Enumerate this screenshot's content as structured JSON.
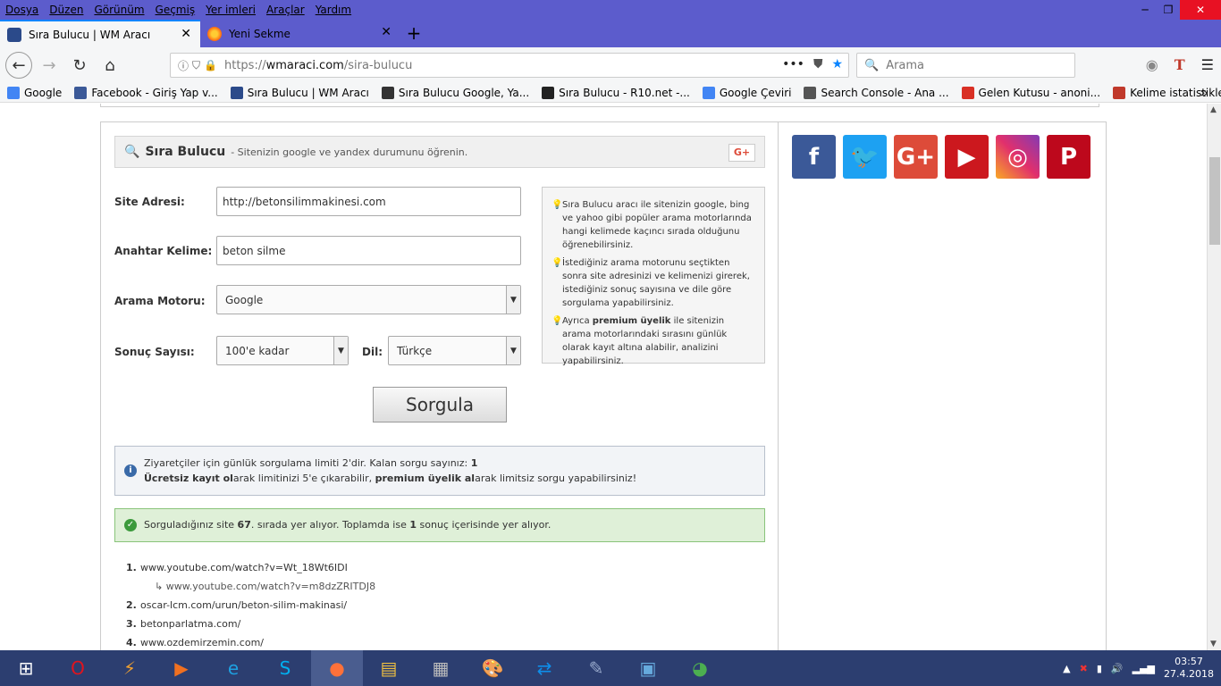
{
  "menu": {
    "items": [
      "Dosya",
      "Düzen",
      "Görünüm",
      "Geçmiş",
      "Yer imleri",
      "Araçlar",
      "Yardım"
    ]
  },
  "window_controls": {
    "minimize": "─",
    "restore": "❐",
    "close": "✕"
  },
  "tabs": [
    {
      "title": "Sıra Bulucu | WM Aracı",
      "active": true,
      "icon": "wm-icon"
    },
    {
      "title": "Yeni Sekme",
      "active": false,
      "icon": "firefox-icon"
    }
  ],
  "navbar": {
    "url_prefix": "https://",
    "url_host": "wmaraci.com",
    "url_path": "/sira-bulucu",
    "search_placeholder": "Arama"
  },
  "bookmarks": [
    {
      "label": "Google",
      "color": "#4285f4"
    },
    {
      "label": "Facebook - Giriş Yap v...",
      "color": "#3b5998"
    },
    {
      "label": "Sıra Bulucu | WM Aracı",
      "color": "#2b4a8a"
    },
    {
      "label": "Sıra Bulucu Google, Ya...",
      "color": "#333333"
    },
    {
      "label": "Sıra Bulucu - R10.net -...",
      "color": "#222222"
    },
    {
      "label": "Google Çeviri",
      "color": "#4285f4"
    },
    {
      "label": "Search Console - Ana ...",
      "color": "#555555"
    },
    {
      "label": "Gelen Kutusu - anoni...",
      "color": "#d93025"
    },
    {
      "label": "Kelime istatistikleri",
      "color": "#c0392b"
    }
  ],
  "panel": {
    "title": "Sıra Bulucu",
    "subtitle": "- Sitenizin google ve yandex durumunu öğrenin.",
    "gplus": "G+"
  },
  "form": {
    "site_label": "Site Adresi:",
    "site_value": "http://betonsilimmakinesi.com",
    "keyword_label": "Anahtar Kelime:",
    "keyword_value": "beton silme",
    "engine_label": "Arama Motoru:",
    "engine_value": "Google",
    "count_label": "Sonuç Sayısı:",
    "count_value": "100'e kadar",
    "lang_label": "Dil:",
    "lang_value": "Türkçe",
    "submit": "Sorgula"
  },
  "info": {
    "p1": "Sıra Bulucu aracı ile sitenizin google, bing ve yahoo gibi popüler arama motorlarında hangi kelimede kaçıncı sırada olduğunu öğrenebilirsiniz.",
    "p2": "İstediğiniz arama motorunu seçtikten sonra site adresinizi ve kelimenizi girerek, istediğiniz sonuç sayısına ve dile göre sorgulama yapabilirsiniz.",
    "p3a": "Ayrıca ",
    "p3b": "premium üyelik",
    "p3c": " ile sitenizin arama motorlarındaki sırasını günlük olarak kayıt altına alabilir, analizini yapabilirsiniz."
  },
  "notice": {
    "line1a": "Ziyaretçiler için günlük sorgulama limiti 2'dir. Kalan sorgu sayınız: ",
    "line1b": "1",
    "line2a": "Ücretsiz kayıt ol",
    "line2b": "arak limitinizi 5'e çıkarabilir, ",
    "line2c": "premium üyelik al",
    "line2d": "arak limitsiz sorgu yapabilirsiniz!"
  },
  "success": {
    "a": "Sorguladığınız site ",
    "rank": "67",
    "b": ". sırada yer alıyor. Toplamda ise ",
    "count": "1",
    "c": " sonuç içerisinde yer alıyor."
  },
  "results": [
    {
      "n": "1.",
      "url": "www.youtube.com/watch?v=Wt_18Wt6IDI"
    },
    {
      "n": "",
      "url": "↳ www.youtube.com/watch?v=m8dzZRITDJ8",
      "sub": true
    },
    {
      "n": "2.",
      "url": "oscar-lcm.com/urun/beton-silim-makinasi/"
    },
    {
      "n": "3.",
      "url": "betonparlatma.com/"
    },
    {
      "n": "4.",
      "url": "www.ozdemirzemin.com/"
    }
  ],
  "social": [
    {
      "name": "facebook",
      "glyph": "f",
      "color": "#3b5998"
    },
    {
      "name": "twitter",
      "glyph": "🐦",
      "color": "#1da1f2"
    },
    {
      "name": "google-plus",
      "glyph": "G+",
      "color": "#dd4b39"
    },
    {
      "name": "youtube",
      "glyph": "▶",
      "color": "#cc181e"
    },
    {
      "name": "instagram",
      "glyph": "◎",
      "color": "#c13584"
    },
    {
      "name": "pinterest",
      "glyph": "P",
      "color": "#bd081c"
    }
  ],
  "clock": {
    "time": "03:57",
    "date": "27.4.2018"
  }
}
